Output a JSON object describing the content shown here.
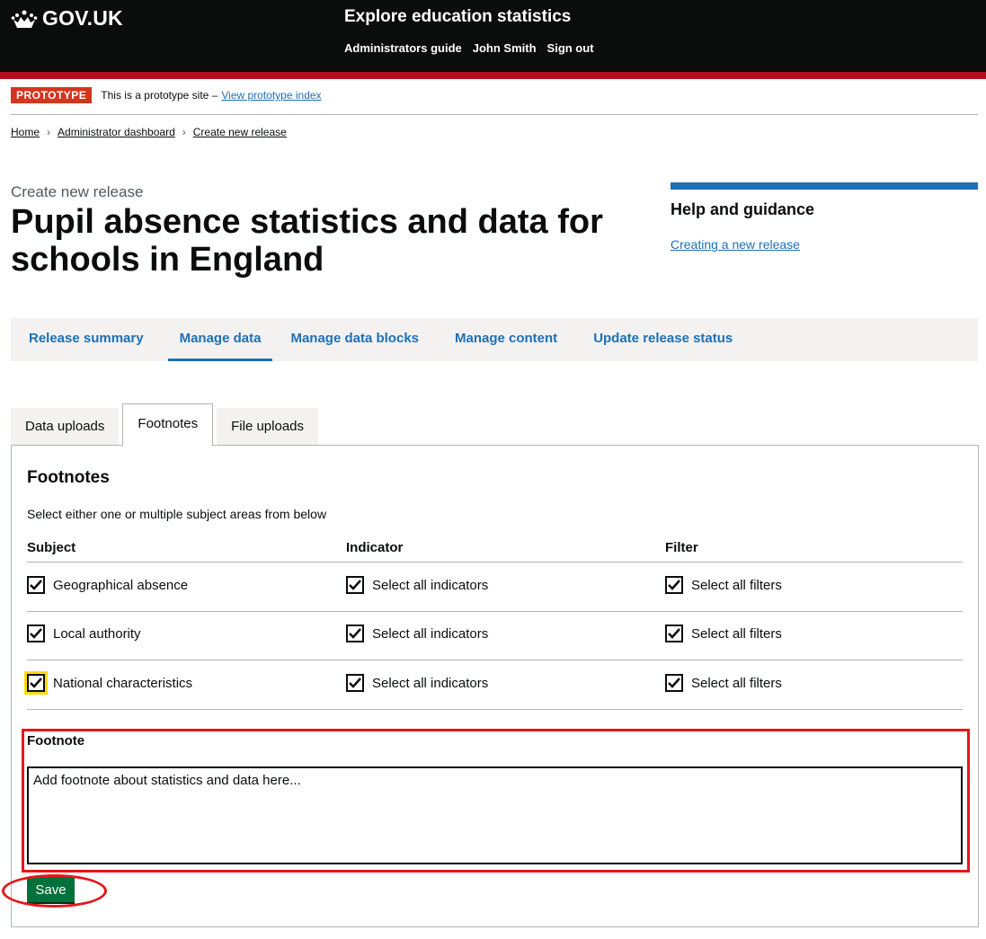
{
  "header": {
    "logo_text": "GOV.UK",
    "logo_icon": "crown-icon",
    "service_name": "Explore education statistics",
    "nav": [
      "Administrators guide",
      "John Smith",
      "Sign out"
    ]
  },
  "banner": {
    "tag": "PROTOTYPE",
    "text": "This is a prototype site –",
    "link": "View prototype index"
  },
  "breadcrumbs": [
    "Home",
    "Administrator dashboard",
    "Create new release"
  ],
  "page": {
    "caption": "Create new release",
    "title": "Pupil absence statistics and data for schools in England"
  },
  "help": {
    "heading": "Help and guidance",
    "link": "Creating a new release"
  },
  "main_nav": {
    "items": [
      "Release summary",
      "Manage data",
      "Manage data blocks",
      "Manage content",
      "Update release status"
    ],
    "active": "Manage data"
  },
  "tabs": {
    "items": [
      "Data uploads",
      "Footnotes",
      "File uploads"
    ],
    "active": "Footnotes"
  },
  "footnotes": {
    "heading": "Footnotes",
    "hint": "Select either one or multiple subject areas from below",
    "columns": [
      "Subject",
      "Indicator",
      "Filter"
    ],
    "rows": [
      {
        "subject": "Geographical absence",
        "indicator": "Select all indicators",
        "filter": "Select all filters",
        "subject_checked": true,
        "indicator_checked": true,
        "filter_checked": true
      },
      {
        "subject": "Local authority",
        "indicator": "Select all indicators",
        "filter": "Select all filters",
        "subject_checked": true,
        "indicator_checked": true,
        "filter_checked": true
      },
      {
        "subject": "National characteristics",
        "indicator": "Select all indicators",
        "filter": "Select all filters",
        "subject_checked": true,
        "indicator_checked": true,
        "filter_checked": true
      }
    ],
    "footnote_label": "Footnote",
    "footnote_placeholder": "Add footnote about statistics and data here...",
    "save_label": "Save"
  },
  "colors": {
    "header_bg": "#0b0c0c",
    "header_stripe": "#b10e1e",
    "link": "#1d70b8",
    "save_button": "#00703c",
    "annotation": "#e4161b",
    "focus": "#ffdd00"
  }
}
